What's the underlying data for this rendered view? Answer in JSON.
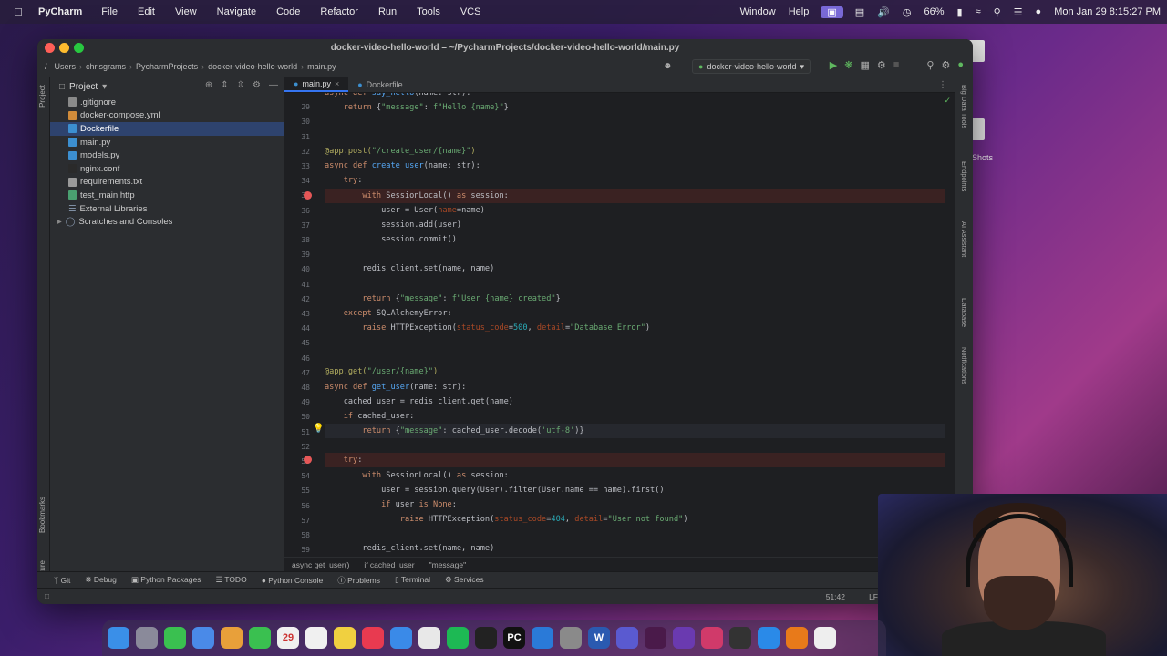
{
  "menubar": {
    "app_name": "PyCharm",
    "items": [
      "File",
      "Edit",
      "View",
      "Navigate",
      "Code",
      "Refactor",
      "Run",
      "Tools",
      "VCS"
    ],
    "right_items": [
      "Window",
      "Help"
    ],
    "battery": "66%",
    "clock": "Mon Jan 29  8:15:27 PM"
  },
  "window": {
    "title": "docker-video-hello-world – ~/PycharmProjects/docker-video-hello-world/main.py",
    "breadcrumbs": [
      "/",
      "Users",
      "chrisgrams",
      "PycharmProjects",
      "docker-video-hello-world",
      "main.py"
    ],
    "run_config": "docker-video-hello-world"
  },
  "project": {
    "header": "Project",
    "files": [
      {
        "name": ".gitignore",
        "color": "#8a8a8a"
      },
      {
        "name": "docker-compose.yml",
        "color": "#d08b3a"
      },
      {
        "name": "Dockerfile",
        "color": "#3c8fd0",
        "selected": true
      },
      {
        "name": "main.py",
        "color": "#3c8fd0"
      },
      {
        "name": "models.py",
        "color": "#3c8fd0"
      },
      {
        "name": "nginx.conf",
        "color": "#2a2a2a"
      },
      {
        "name": "requirements.txt",
        "color": "#9a9a9a"
      },
      {
        "name": "test_main.http",
        "color": "#4aa070"
      }
    ],
    "external": "External Libraries",
    "scratches": "Scratches and Consoles"
  },
  "left_strip": {
    "project": "Project",
    "bookmarks": "Bookmarks",
    "structure": "Structure"
  },
  "tabs": [
    {
      "label": "main.py",
      "active": true
    },
    {
      "label": "Dockerfile",
      "active": false
    }
  ],
  "right_strip": [
    "Big Data Tools",
    "Endpoints",
    "AI Assistant",
    "Database",
    "Notifications"
  ],
  "code": {
    "line_numbers": [
      "",
      "29",
      "30",
      "31",
      "32",
      "33",
      "34",
      "35",
      "36",
      "37",
      "38",
      "39",
      "40",
      "41",
      "42",
      "43",
      "44",
      "45",
      "46",
      "47",
      "48",
      "49",
      "50",
      "51",
      "52",
      "53",
      "54",
      "55",
      "56",
      "57",
      "58",
      "59"
    ]
  },
  "editor_breadcrumbs": [
    "async get_user()",
    "if cached_user",
    "\"message\""
  ],
  "tool_windows": [
    "Git",
    "Debug",
    "Python Packages",
    "TODO",
    "Python Console",
    "Problems",
    "Terminal",
    "Services"
  ],
  "status": {
    "position": "51:42",
    "line_ending": "LF"
  },
  "desktop": {
    "label": "Shots"
  },
  "dock": [
    {
      "name": "finder",
      "color": "#3a8fe8"
    },
    {
      "name": "launchpad",
      "color": "#8a8a9a"
    },
    {
      "name": "messages",
      "color": "#3ac050"
    },
    {
      "name": "appstore-like",
      "color": "#4a8ae8"
    },
    {
      "name": "photos",
      "color": "#e8a03a"
    },
    {
      "name": "facetime",
      "color": "#3ac050"
    },
    {
      "name": "calendar",
      "color": "#f0f0f0",
      "text": "29"
    },
    {
      "name": "reminders",
      "color": "#f0f0f0"
    },
    {
      "name": "notes",
      "color": "#f0d040"
    },
    {
      "name": "music",
      "color": "#e83a50"
    },
    {
      "name": "appstore",
      "color": "#3a8ae8"
    },
    {
      "name": "chrome",
      "color": "#e8e8e8"
    },
    {
      "name": "spotify",
      "color": "#1db954"
    },
    {
      "name": "terminal",
      "color": "#222222"
    },
    {
      "name": "pycharm",
      "color": "#111111",
      "text": "PC"
    },
    {
      "name": "vscode",
      "color": "#2a7ad8"
    },
    {
      "name": "settings",
      "color": "#8a8a8a"
    },
    {
      "name": "word",
      "color": "#2a5ab0",
      "text": "W"
    },
    {
      "name": "teams",
      "color": "#5a5ad0"
    },
    {
      "name": "slack",
      "color": "#4a1a4a"
    },
    {
      "name": "obsidian",
      "color": "#6a3ab0"
    },
    {
      "name": "app-red",
      "color": "#d03a6a"
    },
    {
      "name": "obs",
      "color": "#333333"
    },
    {
      "name": "docker",
      "color": "#2a8ae8"
    },
    {
      "name": "vlc",
      "color": "#e87a1a"
    },
    {
      "name": "files",
      "color": "#eeeeee"
    }
  ]
}
